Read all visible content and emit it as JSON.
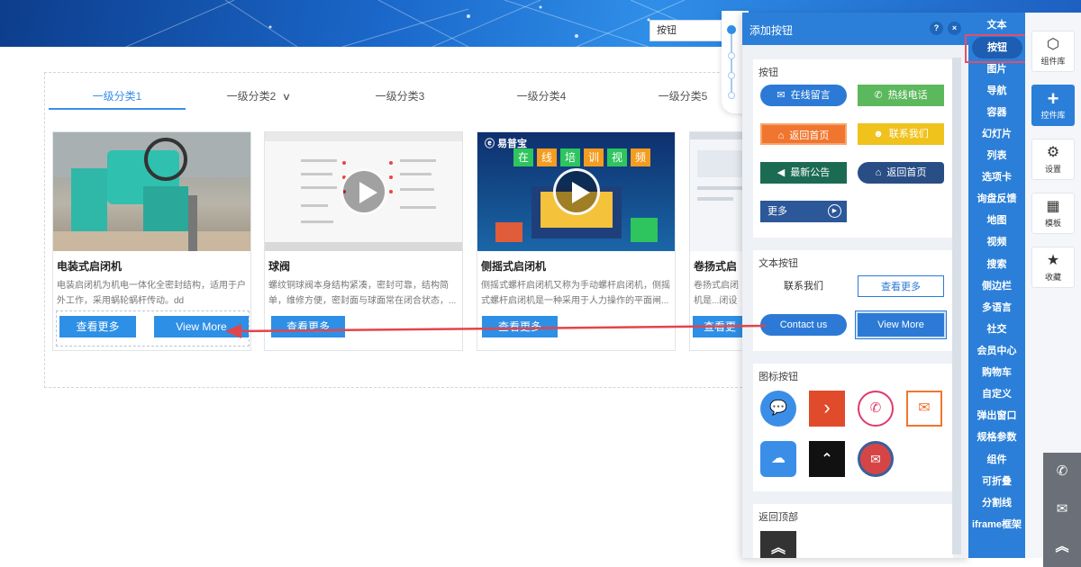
{
  "tabs": [
    "一级分类1",
    "一级分类2",
    "一级分类3",
    "一级分类4",
    "一级分类5"
  ],
  "products": [
    {
      "title": "电装式启闭机",
      "desc": "电装启闭机为机电一体化全密封结构，适用于户外工作，采用蜗轮蜗杆传动。dd",
      "more": "查看更多",
      "more_en": "View More"
    },
    {
      "title": "球阀",
      "desc": "螺纹铜球阀本身结构紧凑，密封可靠，结构简单，维修方便，密封面与球面常在闭合状态，...",
      "more": "查看更多"
    },
    {
      "title": "侧摇式启闭机",
      "desc": "侧摇式螺杆启闭机又称为手动螺杆启闭机，侧摇式螺杆启闭机是一种采用于人力操作的平面闸...",
      "more": "查看更多"
    },
    {
      "title": "卷扬式启",
      "desc": "卷扬式启闭机是...闭设备。快速...",
      "more": "查看更"
    }
  ],
  "video_banner": {
    "brand": "易普宝",
    "headline": [
      "在",
      "线",
      "培",
      "训",
      "视",
      "频"
    ]
  },
  "mini_input": {
    "value": "按钮"
  },
  "panel": {
    "title": "添加按钮",
    "help": "?",
    "close": "×",
    "buttons_section": "按钮",
    "buttons": {
      "online_msg": "在线留言",
      "hotline": "热线电话",
      "home1": "返回首页",
      "contact": "联系我们",
      "notice": "最新公告",
      "home2": "返回首页",
      "more": "更多"
    },
    "text_buttons_section": "文本按钮",
    "text_buttons": {
      "contact": "联系我们",
      "see_more": "查看更多",
      "contact_us": "Contact us",
      "view_more": "View More"
    },
    "icon_buttons_section": "图标按钮",
    "back_top_section": "返回顶部"
  },
  "rail": [
    "文本",
    "按钮",
    "图片",
    "导航",
    "容器",
    "幻灯片",
    "列表",
    "选项卡",
    "询盘反馈",
    "地图",
    "视频",
    "搜索",
    "侧边栏",
    "多语言",
    "社交",
    "会员中心",
    "购物车",
    "自定义",
    "弹出窗口",
    "规格参数",
    "组件",
    "可折叠",
    "分割线",
    "iframe框架"
  ],
  "tools": {
    "components": "组件库",
    "add": "控件库",
    "settings": "设置",
    "templates": "模板",
    "favorites": "收藏"
  },
  "colors": {
    "accent": "#2b7fd8",
    "button": "#2e8fe6",
    "arrow": "#e2454a"
  }
}
